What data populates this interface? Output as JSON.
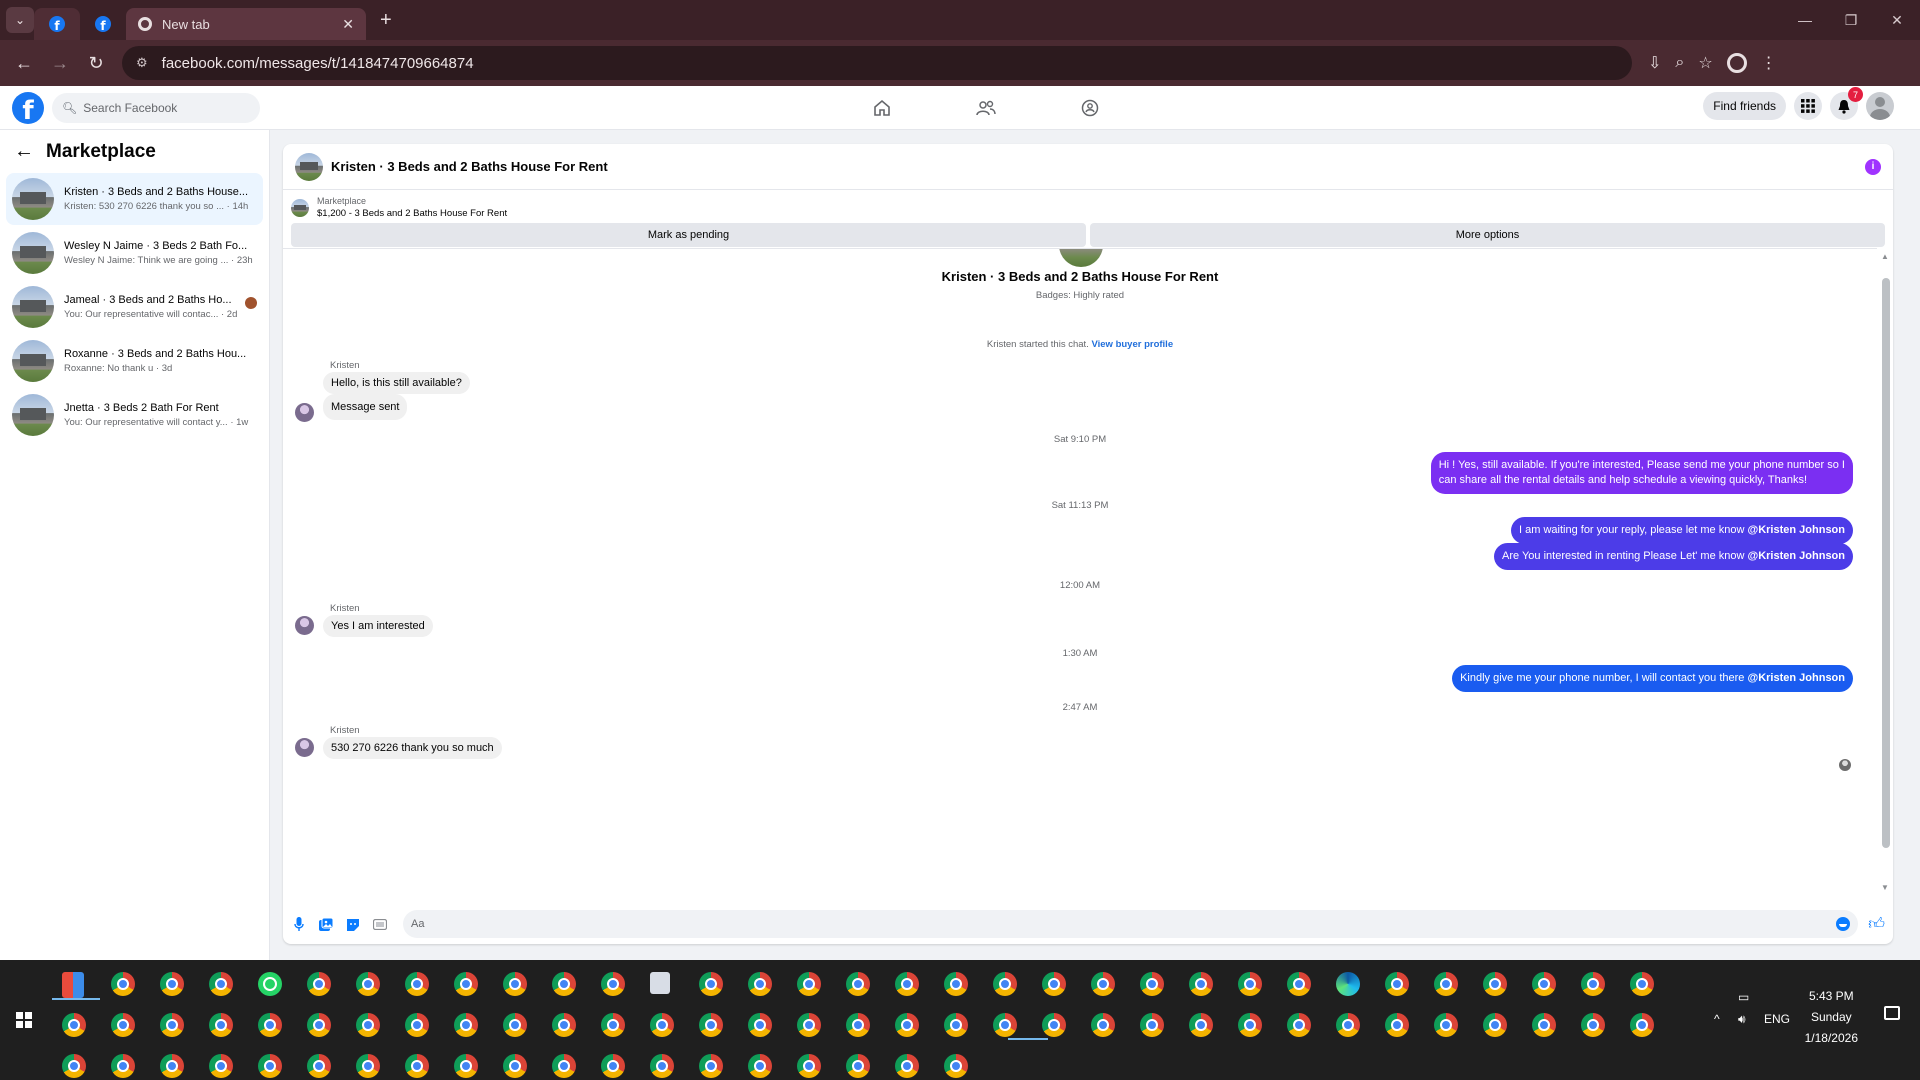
{
  "browser": {
    "tabs": [
      {
        "title": "",
        "icon": "facebook-icon"
      },
      {
        "title": "",
        "icon": "facebook-icon"
      },
      {
        "title": "New tab",
        "icon": "chrome-icon"
      }
    ],
    "url": "facebook.com/messages/t/1418474709664874"
  },
  "fb_nav": {
    "search_placeholder": "Search Facebook",
    "find_friends": "Find friends",
    "notification_count": "7"
  },
  "sidebar": {
    "title": "Marketplace",
    "conversations": [
      {
        "title": "Kristen · 3 Beds and 2 Baths House...",
        "preview": "Kristen: 530 270 6226 thank you so ... · 14h"
      },
      {
        "title": "Wesley N Jaime · 3 Beds 2 Bath Fo...",
        "preview": "Wesley N Jaime: Think we are going ... · 23h"
      },
      {
        "title": "Jameal · 3 Beds and 2 Baths Ho...",
        "preview": "You: Our representative will contac... · 2d"
      },
      {
        "title": "Roxanne · 3 Beds and 2 Baths Hou...",
        "preview": "Roxanne: No thank u · 3d"
      },
      {
        "title": "Jnetta · 3 Beds 2 Bath For Rent",
        "preview": "You: Our representative will contact y... · 1w"
      }
    ]
  },
  "chat": {
    "title": "Kristen · 3 Beds and 2 Baths House For Rent",
    "listing_category": "Marketplace",
    "listing_name": "$1,200 - 3 Beds and 2 Baths House For Rent",
    "mark_pending": "Mark as pending",
    "more_options": "More options",
    "conversation_title": "Kristen · 3 Beds and 2 Baths House For Rent",
    "badges": "Badges: Highly rated",
    "started_text": "Kristen started this chat.",
    "view_profile": "View buyer profile",
    "sender": "Kristen",
    "messages": {
      "m1": "Hello, is this still available?",
      "m2": "Message sent",
      "ts1": "Sat 9:10 PM",
      "m3_line1": "Hi ! Yes, still available. If you're interested, Please send me your phone number so I",
      "m3_line2": "can share all the rental details and help schedule a viewing quickly, Thanks!",
      "ts2": "Sat 11:13 PM",
      "m4_text": "I am waiting for your reply, please let me know",
      "m5_text": "Are You  interested in renting Please Let' me know",
      "mention": "@Kristen Johnson",
      "ts3": "12:00 AM",
      "m6": "Yes I am interested",
      "ts4": "1:30 AM",
      "m7_text": "Kindly give me your phone number, I will contact you there",
      "ts5": "2:47 AM",
      "m8": "530 270 6226  thank you so much"
    },
    "composer_placeholder": "Aa",
    "colors": {
      "bubble_purple": "#7b2ff2",
      "bubble_indigo": "#4c3ce8",
      "bubble_blue": "#1a5cf0",
      "accent": "#0a7cff"
    }
  },
  "taskbar": {
    "lang": "ENG",
    "time": "5:43 PM",
    "day": "Sunday",
    "date": "1/18/2026"
  }
}
